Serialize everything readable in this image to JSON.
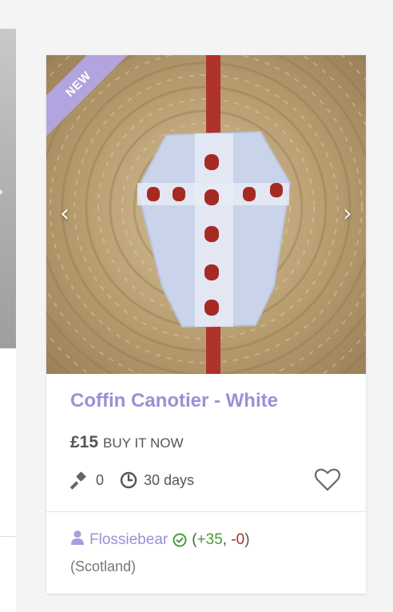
{
  "listing": {
    "badge": "NEW",
    "title": "Coffin Canotier - White",
    "price": "£15",
    "purchase_type": "BUY IT NOW",
    "bids": "0",
    "time_left": "30 days",
    "icons": {
      "gavel": "gavel-icon",
      "clock": "clock-icon",
      "watch": "heart-icon",
      "prev": "chevron-left-icon",
      "next": "chevron-right-icon"
    }
  },
  "seller": {
    "name": "Flossiebear",
    "feedback_open": "(",
    "positive": "+35",
    "sep": ", ",
    "negative": "-0",
    "feedback_close": ")",
    "location": "(Scotland)"
  },
  "colors": {
    "accent": "#9c8fd6",
    "badge": "#b3a4e0",
    "positive": "#4a9b3a",
    "negative": "#a33030"
  }
}
